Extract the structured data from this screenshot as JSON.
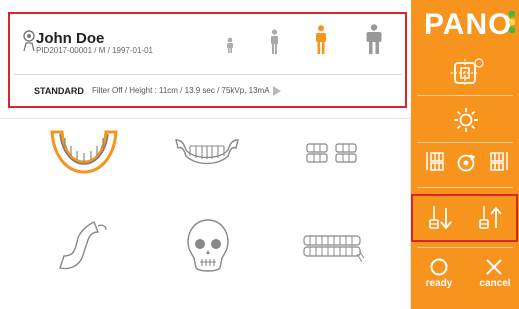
{
  "app": {
    "logo": "PANO"
  },
  "patient": {
    "name": "John Doe",
    "id_line": "PID2017-00001 / M / 1997-01-01"
  },
  "mode": {
    "label": "STANDARD",
    "detail": "Filter Off / Height : 11cm / 13.9 sec / 75kVp, 13mA"
  },
  "patient_sizes": [
    {
      "name": "child",
      "selected": false
    },
    {
      "name": "small-adult",
      "selected": false
    },
    {
      "name": "medium-adult",
      "selected": true
    },
    {
      "name": "large-adult",
      "selected": false
    }
  ],
  "exam_programs": [
    {
      "name": "panoramic-arch",
      "selected": true
    },
    {
      "name": "frontal-teeth",
      "selected": false
    },
    {
      "name": "bitewing",
      "selected": false
    },
    {
      "name": "tmj",
      "selected": false
    },
    {
      "name": "skull",
      "selected": false
    },
    {
      "name": "full-arch-occlusal",
      "selected": false
    }
  ],
  "side_panel": {
    "ready_label": "ready",
    "cancel_label": "cancel"
  },
  "colors": {
    "accent": "#f7941d",
    "highlight": "#d9262c",
    "icon_gray": "#9a9a9a",
    "led_green": "#43b649",
    "led_yellow": "#f4e04d"
  }
}
